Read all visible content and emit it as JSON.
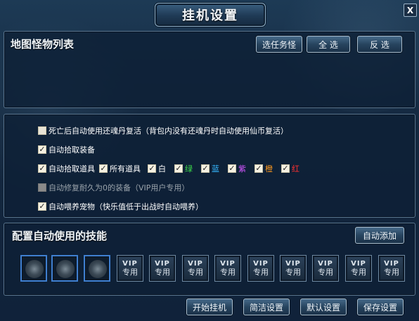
{
  "window": {
    "title": "挂机设置",
    "close_label": "X"
  },
  "monster_panel": {
    "title": "地图怪物列表",
    "buttons": {
      "select_monster": "选任务怪",
      "select_all": "全 选",
      "invert": "反 选"
    }
  },
  "options": {
    "revive": {
      "label": "死亡后自动使用还魂丹复活（背包内没有还魂丹时自动使用仙币复活）",
      "checked": false
    },
    "pick_equip": {
      "label": "自动拾取装备",
      "checked": true
    },
    "pick_items": {
      "label": "自动拾取道具",
      "checked": true
    },
    "quality_filters": [
      {
        "label": "所有道具",
        "checked": true,
        "color": "#ffffff"
      },
      {
        "label": "白",
        "checked": true,
        "color": "#ffffff"
      },
      {
        "label": "绿",
        "checked": true,
        "color": "#3ddc4a"
      },
      {
        "label": "蓝",
        "checked": true,
        "color": "#36b8ff"
      },
      {
        "label": "紫",
        "checked": true,
        "color": "#d255ff"
      },
      {
        "label": "橙",
        "checked": true,
        "color": "#ff9a1f"
      },
      {
        "label": "红",
        "checked": true,
        "color": "#ff3030"
      }
    ],
    "repair": {
      "label": "自动修复耐久为0的装备（VIP用户专用）",
      "checked": false,
      "disabled": true
    },
    "feed_pet": {
      "label": "自动喂养宠物（快乐值低于出战时自动喂养）",
      "checked": true
    }
  },
  "skills_panel": {
    "title": "配置自动使用的技能",
    "auto_add": "自动添加",
    "slots": [
      {
        "type": "skill",
        "icon": "skill-emblem-icon"
      },
      {
        "type": "skill",
        "icon": "skill-emblem-icon"
      },
      {
        "type": "skill",
        "icon": "skill-emblem-icon"
      },
      {
        "type": "vip",
        "line1": "VIP",
        "line2": "专用"
      },
      {
        "type": "vip",
        "line1": "VIP",
        "line2": "专用"
      },
      {
        "type": "vip",
        "line1": "VIP",
        "line2": "专用"
      },
      {
        "type": "vip",
        "line1": "VIP",
        "line2": "专用"
      },
      {
        "type": "vip",
        "line1": "VIP",
        "line2": "专用"
      },
      {
        "type": "vip",
        "line1": "VIP",
        "line2": "专用"
      },
      {
        "type": "vip",
        "line1": "VIP",
        "line2": "专用"
      },
      {
        "type": "vip",
        "line1": "VIP",
        "line2": "专用"
      },
      {
        "type": "vip",
        "line1": "VIP",
        "line2": "专用"
      }
    ]
  },
  "footer": {
    "start": "开始挂机",
    "simple": "简洁设置",
    "default": "默认设置",
    "save": "保存设置"
  },
  "colors": {
    "accent_border": "#3f7fd0",
    "panel_border": "#59758f",
    "text": "#ffffff"
  }
}
